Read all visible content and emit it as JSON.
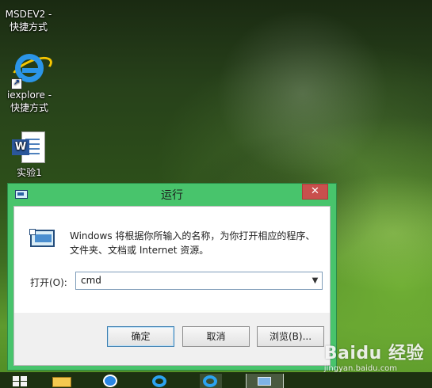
{
  "desktop": {
    "icons": [
      {
        "label_line1": "MSDEV2 -",
        "label_line2": "快捷方式",
        "icon": "shortcut-icon"
      },
      {
        "label_line1": "iexplore -",
        "label_line2": "快捷方式",
        "icon": "internet-explorer-icon"
      },
      {
        "label_line1": "实验1",
        "label_line2": "",
        "icon": "word-document-icon"
      }
    ]
  },
  "dialog": {
    "title": "运行",
    "close_label": "✕",
    "description_line1": "Windows 将根据你所输入的名称，为你打开相应的程序、",
    "description_line2": "文件夹、文档或 Internet 资源。",
    "open_label": "打开(O):",
    "open_value": "cmd",
    "buttons": {
      "ok": "确定",
      "cancel": "取消",
      "browse": "浏览(B)..."
    }
  },
  "taskbar": {
    "items": [
      "start-icon",
      "folder-icon",
      "mail-icon",
      "internet-explorer-icon",
      "internet-explorer-icon",
      "run-icon"
    ]
  },
  "watermark": {
    "logo": "Baidu 经验",
    "url": "jingyan.baidu.com"
  },
  "colors": {
    "dialog_frame": "#48c46c",
    "close_button": "#c9504d",
    "taskbar": "#1d3111"
  }
}
